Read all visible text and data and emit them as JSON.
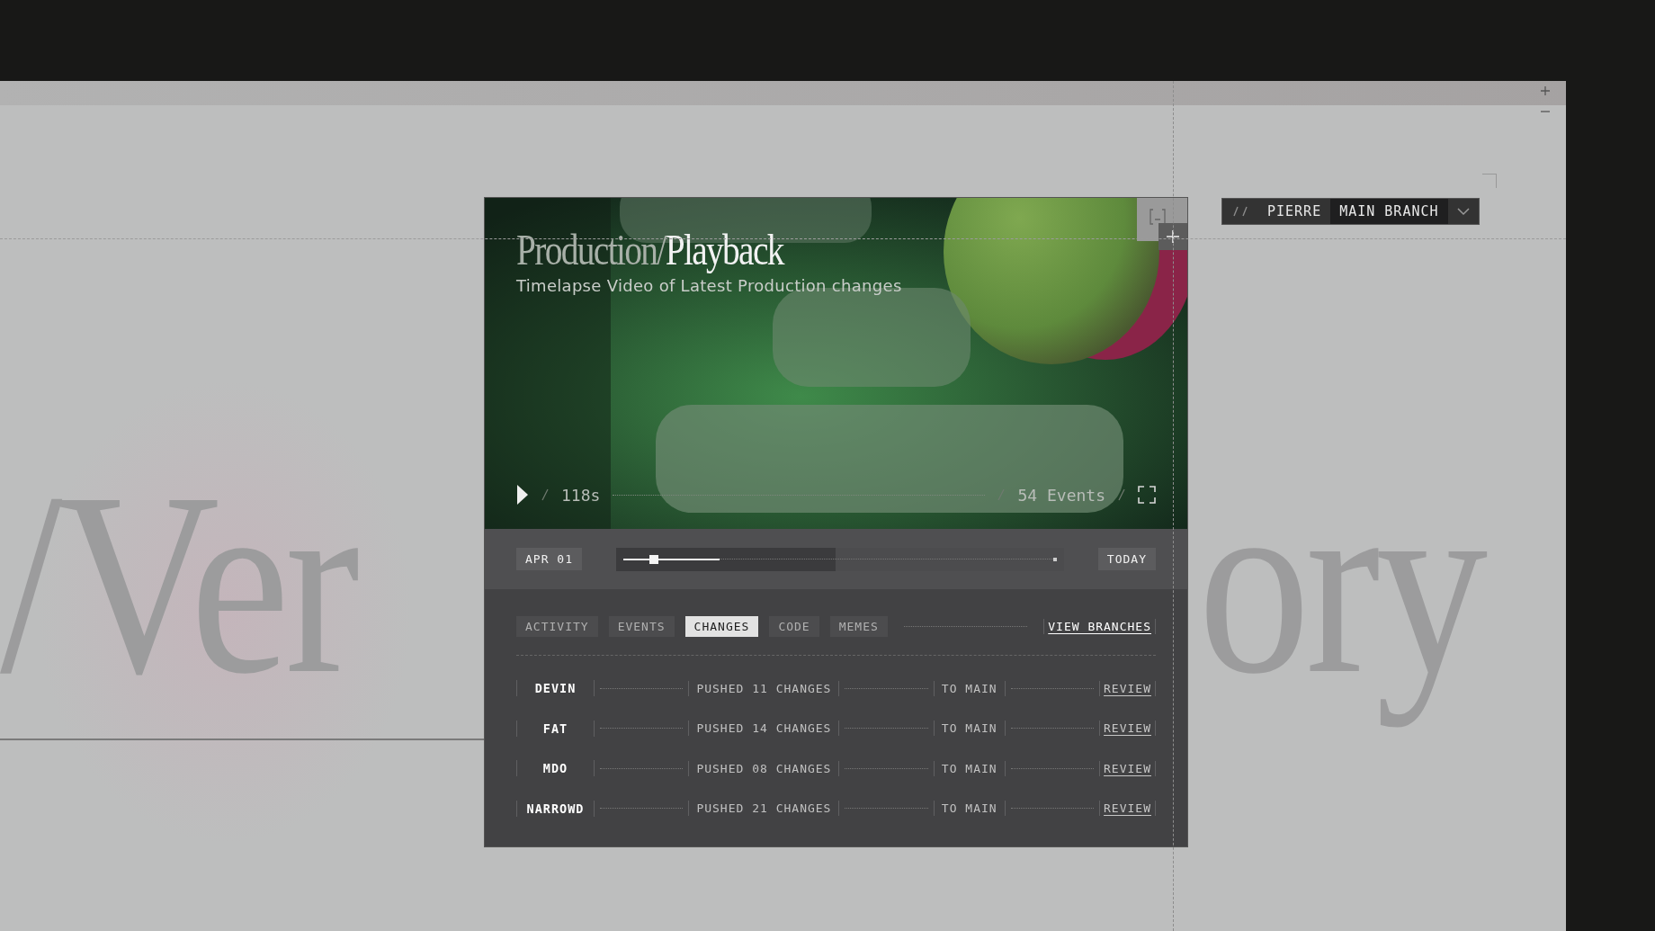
{
  "backdrop_text": [
    "/Ver",
    "ory"
  ],
  "branch_switcher": {
    "user": "PIERRE",
    "branch": "MAIN BRANCH"
  },
  "player": {
    "title_prefix": "Production/",
    "title": "Playback",
    "subtitle": "Timelapse Video of Latest Production changes",
    "playing": false,
    "duration": "118s",
    "events": "54 Events"
  },
  "timeline": {
    "start": "APR 01",
    "end": "TODAY",
    "level": 0.07
  },
  "tabs": [
    {
      "label": "ACTIVITY",
      "selected": false
    },
    {
      "label": "EVENTS",
      "selected": false
    },
    {
      "label": "CHANGES",
      "selected": true
    },
    {
      "label": "CODE",
      "selected": false
    },
    {
      "label": "MEMES",
      "selected": false
    }
  ],
  "view_branches": "VIEW BRANCHES",
  "changes": [
    {
      "author": "DEVIN",
      "summary": "PUSHED 11 CHANGES",
      "target": "TO MAIN",
      "action": "REVIEW"
    },
    {
      "author": "FAT",
      "summary": "PUSHED 14 CHANGES",
      "target": "TO MAIN",
      "action": "REVIEW"
    },
    {
      "author": "MDO",
      "summary": "PUSHED 08 CHANGES",
      "target": "TO MAIN",
      "action": "REVIEW"
    },
    {
      "author": "NARROWD",
      "summary": "PUSHED 21 CHANGES",
      "target": "TO MAIN",
      "action": "REVIEW"
    }
  ]
}
